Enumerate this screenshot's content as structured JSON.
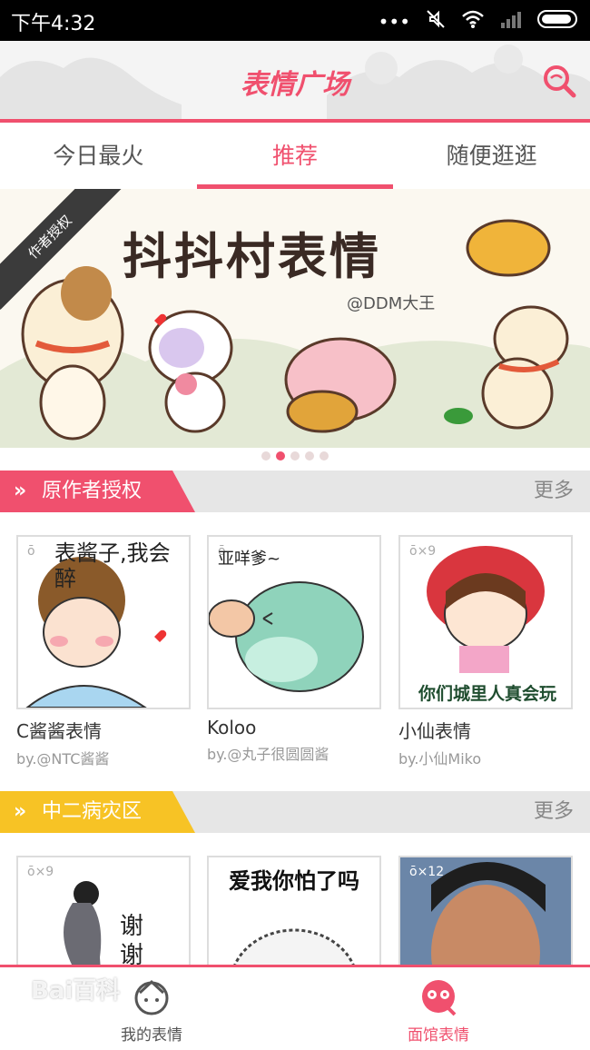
{
  "status_bar": {
    "time": "下午4:32",
    "more_icon": "three-dots-icon",
    "mute_icon": "mute-icon",
    "wifi_icon": "wifi-icon",
    "signal_icon": "signal-icon",
    "battery_icon": "battery-icon"
  },
  "header": {
    "title": "表情广场",
    "search_icon": "search-icon",
    "accent": "#f0506e"
  },
  "tabs": [
    {
      "label": "今日最火",
      "active": false
    },
    {
      "label": "推荐",
      "active": true
    },
    {
      "label": "随便逛逛",
      "active": false
    }
  ],
  "banner": {
    "title": "抖抖村表情",
    "author": "@DDM大王",
    "ribbon": "作者授权",
    "page_count": 5,
    "active_page": 2
  },
  "sections": [
    {
      "title": "原作者授权",
      "more": "更多",
      "color": "#f0506e",
      "items": [
        {
          "name": "C酱酱表情",
          "by": "by.@NTC酱酱",
          "badge": "",
          "caption": "表酱子,我会醉"
        },
        {
          "name": "Koloo",
          "by": "by.@丸子很圆圆酱",
          "badge": "",
          "caption": "亚咩爹~"
        },
        {
          "name": "小仙表情",
          "by": "by.小仙Miko",
          "badge": "×9",
          "caption": "你们城里人真会玩"
        }
      ]
    },
    {
      "title": "中二病灾区",
      "more": "更多",
      "color": "#f7c325",
      "items": [
        {
          "name": "",
          "by": "",
          "badge": "×9",
          "caption": "谢谢"
        },
        {
          "name": "",
          "by": "",
          "badge": "",
          "caption": "爱我你怕了吗"
        },
        {
          "name": "",
          "by": "",
          "badge": "×12",
          "caption": ""
        }
      ]
    }
  ],
  "bottom_nav": [
    {
      "label": "我的表情",
      "icon": "face-icon",
      "active": false
    },
    {
      "label": "面馆表情",
      "icon": "bowl-face-icon",
      "active": true
    }
  ],
  "watermark": "Bai百科"
}
